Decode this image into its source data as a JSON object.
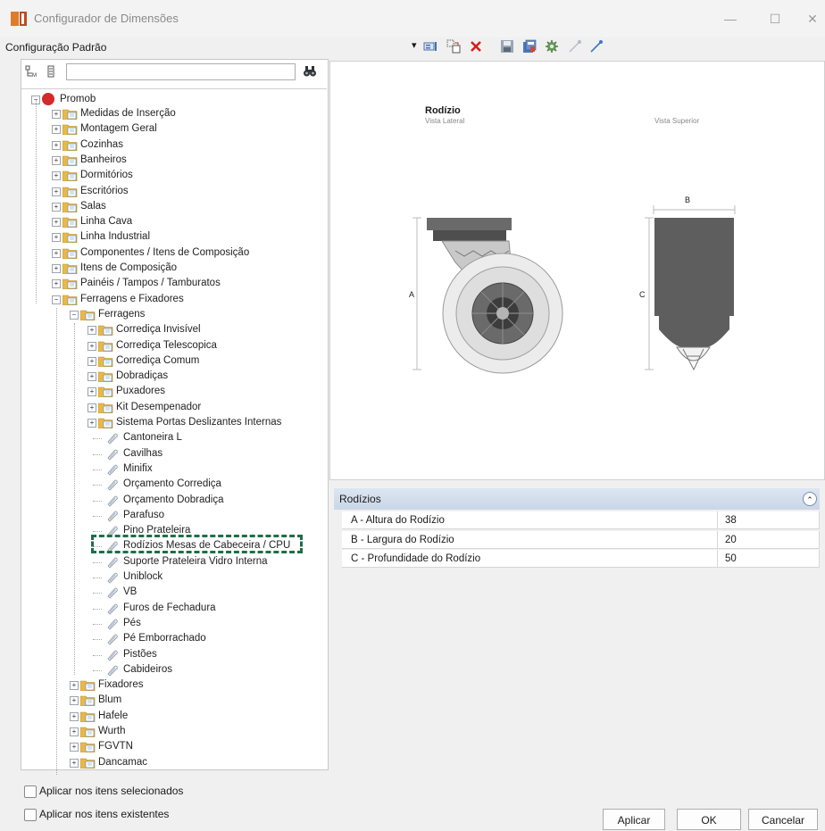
{
  "window": {
    "title": "Configurador de Dimensões",
    "minimize": "—",
    "maximize": "☐",
    "close": "✕"
  },
  "toolbar": {
    "config_name": "Configuração Padrão",
    "dropdown_glyph": "▾"
  },
  "search": {
    "value": "",
    "placeholder": ""
  },
  "tree": {
    "root": "Promob",
    "level1": [
      "Medidas de Inserção",
      "Montagem Geral",
      "Cozinhas",
      "Banheiros",
      "Dormitórios",
      "Escritórios",
      "Salas",
      "Linha Cava",
      "Linha Industrial",
      "Componentes / Itens de Composição",
      "Itens de Composição",
      "Painéis / Tampos / Tamburatos",
      "Ferragens e Fixadores"
    ],
    "ferragens": "Ferragens",
    "ferragens_folders": [
      "Corrediça Invisível",
      "Corrediça Telescopica",
      "Corrediça Comum",
      "Dobradiças",
      "Puxadores",
      "Kit Desempenador",
      "Sistema Portas Deslizantes Internas"
    ],
    "ferragens_items": [
      "Cantoneira L",
      "Cavilhas",
      "Minifix",
      "Orçamento Corrediça",
      "Orçamento Dobradiça",
      "Parafuso",
      "Pino Prateleira",
      "Rodízios Mesas de Cabeceira / CPU",
      "Suporte Prateleira Vidro Interna",
      "Uniblock",
      "VB",
      "Furos de Fechadura",
      "Pés",
      "Pé Emborrachado",
      "Pistões",
      "Cabideiros"
    ],
    "other_folders": [
      "Fixadores",
      "Blum",
      "Hafele",
      "Wurth",
      "FGVTN",
      "Dancamac"
    ],
    "selected_index": 7
  },
  "preview": {
    "title": "Rodízio",
    "side_view": "Vista Lateral",
    "top_view": "Vista Superior",
    "dim_a": "A",
    "dim_b": "B",
    "dim_c": "C"
  },
  "properties": {
    "header": "Rodízios",
    "collapse_glyph": "⌃",
    "rows": [
      {
        "label": "A - Altura do Rodízio",
        "value": "38"
      },
      {
        "label": "B - Largura do Rodízio",
        "value": "20"
      },
      {
        "label": "C - Profundidade do Rodízio",
        "value": "50"
      }
    ]
  },
  "options": {
    "apply_selected": "Aplicar nos itens selecionados",
    "apply_existing": "Aplicar nos itens existentes"
  },
  "buttons": {
    "apply": "Aplicar",
    "ok": "OK",
    "cancel": "Cancelar"
  },
  "colors": {
    "highlight_dash": "#1e6e4a",
    "header_bg": "#d3deec",
    "folder": "#e8b84a"
  }
}
